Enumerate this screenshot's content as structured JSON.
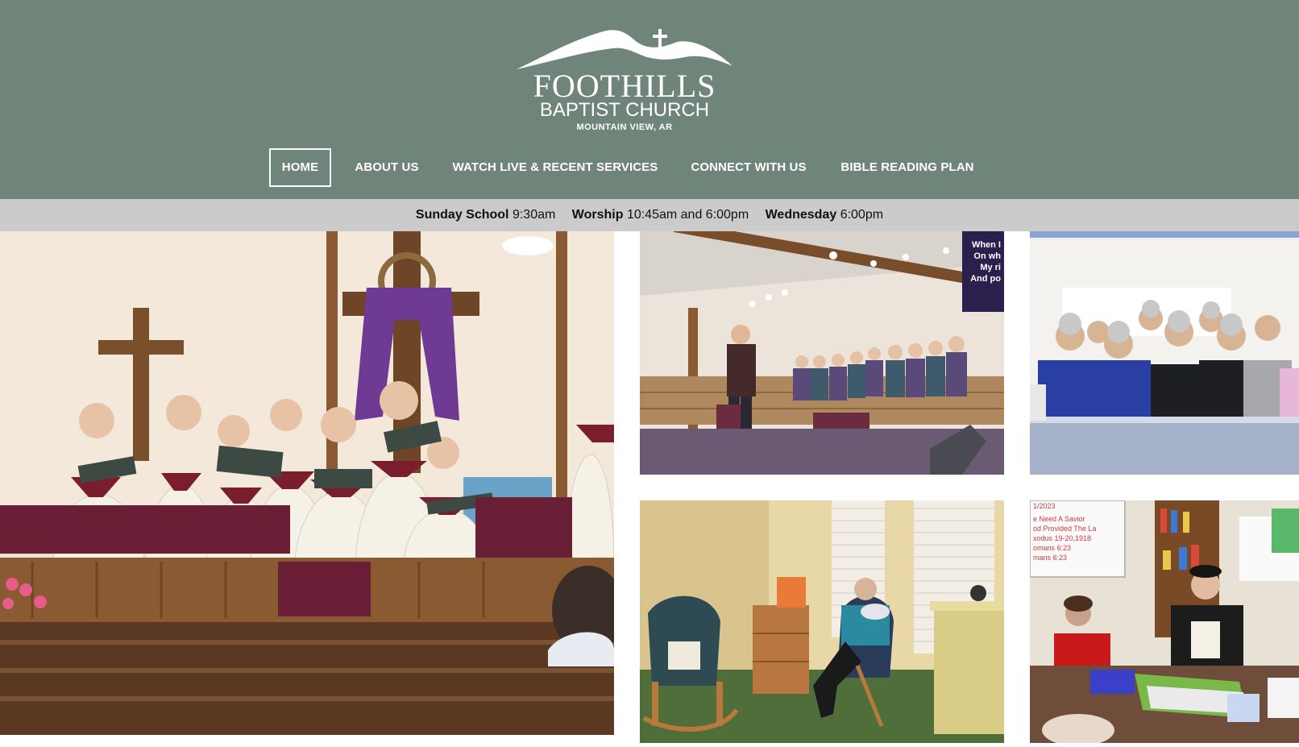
{
  "site": {
    "logo": {
      "name": "FOOTHILLS",
      "subtitle": "BAPTIST CHURCH",
      "location": "MOUNTAIN VIEW, AR"
    },
    "colors": {
      "header_bg": "#6f8579",
      "schedule_bg": "#cbcbcb",
      "nav_text": "#ffffff"
    }
  },
  "nav": {
    "items": [
      {
        "label": "HOME",
        "active": true
      },
      {
        "label": "ABOUT US",
        "active": false
      },
      {
        "label": "WATCH LIVE & RECENT SERVICES",
        "active": false
      },
      {
        "label": "CONNECT WITH US",
        "active": false
      },
      {
        "label": "BIBLE READING PLAN",
        "active": false
      }
    ]
  },
  "schedule": [
    {
      "day": "Sunday School",
      "time": "9:30am"
    },
    {
      "day": "Worship",
      "time": "10:45am and 6:00pm"
    },
    {
      "day": "Wednesday",
      "time": "6:00pm"
    }
  ],
  "screen_slide": {
    "lines": [
      "When I",
      "On wh",
      "My ri",
      "And po"
    ]
  },
  "whiteboard": {
    "lines": [
      "1/2023",
      "e Need A Savior",
      "od Provided The La",
      "xodus 19-20,1918",
      "omans 6:23",
      "mans 6:23"
    ]
  }
}
